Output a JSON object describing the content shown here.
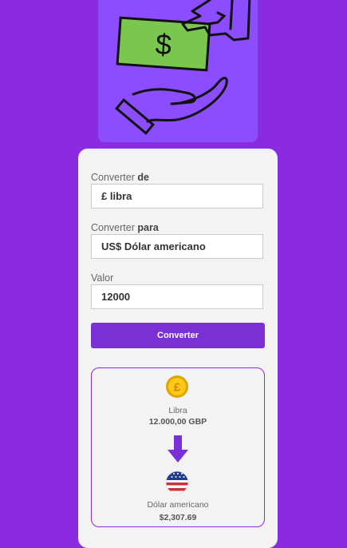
{
  "form": {
    "from_label": {
      "prefix": "Converter",
      "strong": "de"
    },
    "from_value": "£ libra",
    "to_label": {
      "prefix": "Converter",
      "strong": "para"
    },
    "to_value": "US$ Dólar americano",
    "amount_label": "Valor",
    "amount_value": "12000",
    "convert_button": "Converter"
  },
  "result": {
    "from_name": "Libra",
    "from_amount": "12.000,00 GBP",
    "to_name": "Dólar americano",
    "to_amount": "$2,307.69"
  },
  "icons": {
    "hero": "money-exchange-icon",
    "from": "pound-coin-icon",
    "arrow": "arrow-down-icon",
    "to": "us-flag-icon"
  },
  "colors": {
    "background": "#8a2be2",
    "hero_background": "#8c4dff",
    "button": "#7b30d6",
    "card": "#f3f3f3"
  }
}
